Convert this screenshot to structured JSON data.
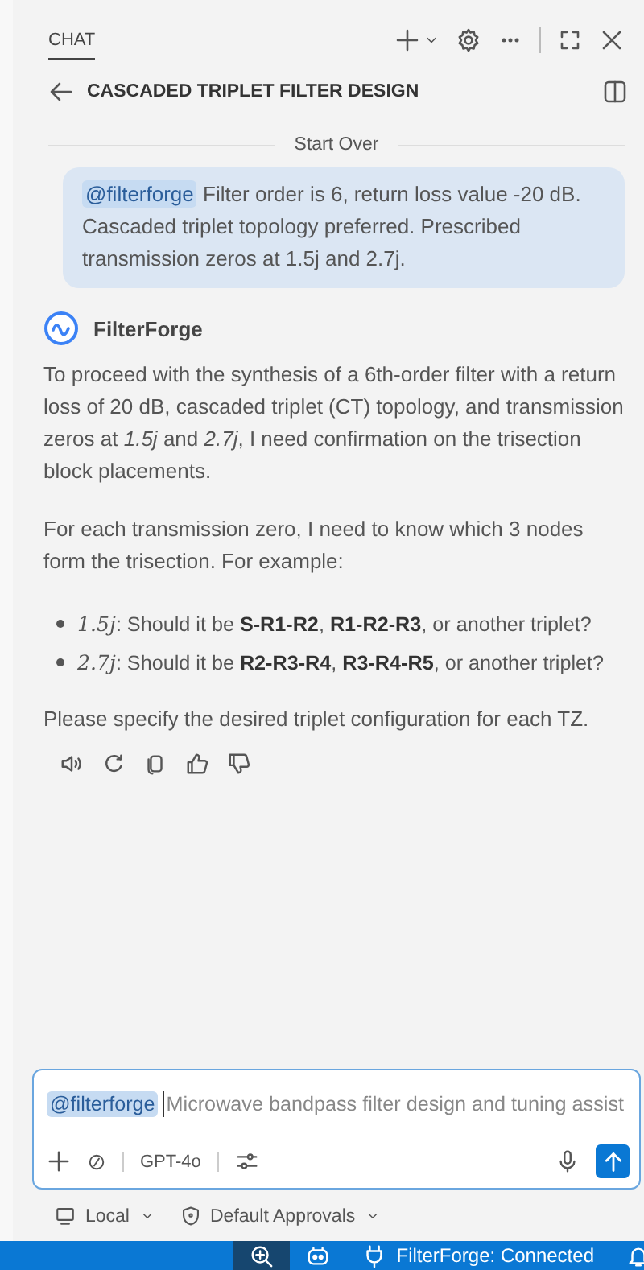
{
  "header": {
    "tab": "CHAT",
    "tab_selected": true
  },
  "title_bar": {
    "title": "CASCADED TRIPLET FILTER DESIGN"
  },
  "divider_label": "Start Over",
  "user_message": {
    "mention": "@filterforge",
    "text": "Filter order is 6, return loss value -20 dB. Cascaded triplet topology preferred. Prescribed transmission zeros at 1.5j and 2.7j."
  },
  "assistant": {
    "name": "FilterForge",
    "paragraphs": [
      "To proceed with the synthesis of a 6th-order filter with a return loss of 20 dB, cascaded triplet (CT) topology, and transmission zeros at *1.5j* and *2.7j*, I need confirmation on the trisection block placements.",
      "For each transmission zero, I need to know which 3 nodes form the trisection. For example:"
    ],
    "bullets": [
      {
        "term": "1.5j",
        "text": ": Should it be **S-R1-R2**, **R1-R2-R3**, or another triplet?"
      },
      {
        "term": "2.7j",
        "text": ": Should it be **R2-R3-R4**, **R3-R4-R5**, or another triplet?"
      }
    ],
    "closing": "Please specify the desired triplet configuration for each TZ."
  },
  "composer": {
    "mention": "@filterforge",
    "placeholder": "Microwave bandpass filter design and tuning assist",
    "model": "GPT-4o"
  },
  "footer": {
    "location": "Local",
    "approvals": "Default Approvals"
  },
  "status_bar": {
    "items": [
      {
        "kind": "zoom",
        "selected": true
      },
      {
        "kind": "copilot",
        "selected": false
      },
      {
        "kind": "plug",
        "label": "FilterForge: Connected",
        "selected": false
      },
      {
        "kind": "bell",
        "selected": false
      }
    ]
  }
}
